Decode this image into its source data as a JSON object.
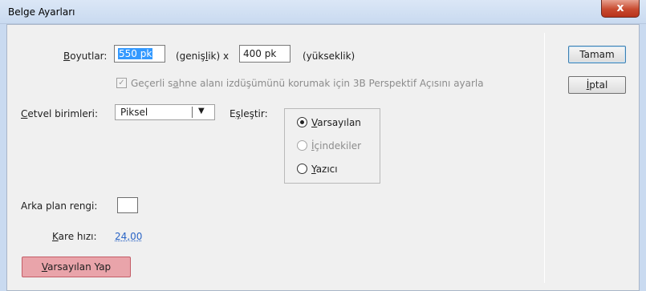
{
  "window": {
    "title": "Belge Ayarları",
    "close_glyph": "x"
  },
  "dimensions": {
    "label_prefix": "B",
    "label_rest": "oyutlar:",
    "width_value": "550 pk",
    "width_suffix_a": "(geniş",
    "width_suffix_u": "l",
    "width_suffix_b": "ik) x",
    "height_value": "400 pk",
    "height_suffix": "(yükseklik)",
    "perspective_checkbox": {
      "checked": true,
      "glyph": "✓",
      "text_a": "Geçerli s",
      "text_u": "a",
      "text_b": "hne alanı izdüşümünü korumak için 3B Perspektif Açısını ayarla"
    }
  },
  "ruler": {
    "label_u": "C",
    "label_rest": "etvel birimleri:",
    "selected": "Piksel",
    "arrow": "▼"
  },
  "match": {
    "label_a": "E",
    "label_u": "ş",
    "label_b": "leştir:",
    "options": [
      {
        "u": "V",
        "rest": "arsayılan",
        "selected": true,
        "enabled": true
      },
      {
        "u": "İ",
        "rest": "çindekiler",
        "selected": false,
        "enabled": false
      },
      {
        "u": "Y",
        "rest": "azıcı",
        "selected": false,
        "enabled": true
      }
    ]
  },
  "background": {
    "label": "Arka plan rengi:",
    "color": "#ffffff"
  },
  "frame_rate": {
    "label_u": "K",
    "label_rest": "are hızı:",
    "value": "24,00"
  },
  "buttons": {
    "ok": "Tamam",
    "cancel_u": "İ",
    "cancel_rest": "ptal",
    "reset_u": "V",
    "reset_rest": "arsayılan Yap"
  },
  "colors": {
    "accent": "#3399ff",
    "link": "#2a64c5",
    "highlight_button": "#e9a4aa"
  }
}
